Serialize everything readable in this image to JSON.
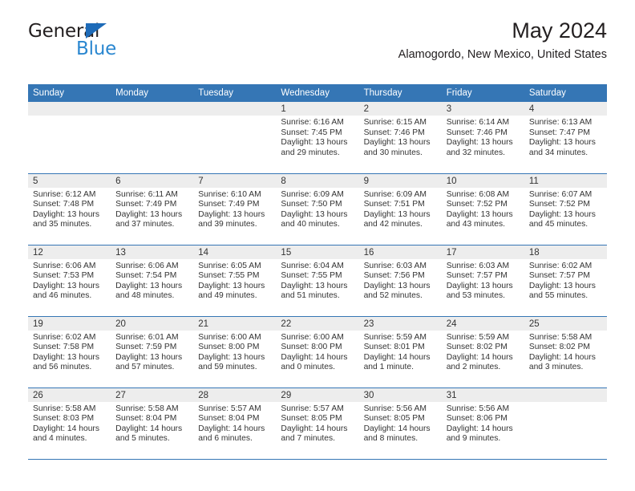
{
  "brand": {
    "name_top": "General",
    "name_bottom": "Blue",
    "triangle_color": "#1e6bb8",
    "blue_color": "#2a87d0",
    "dark_color": "#231f20"
  },
  "header": {
    "title": "May 2024",
    "subtitle": "Alamogordo, New Mexico, United States"
  },
  "theme": {
    "header_blue": "#3576b5",
    "daynum_band": "#ededed",
    "text": "#333333"
  },
  "weekdays": [
    "Sunday",
    "Monday",
    "Tuesday",
    "Wednesday",
    "Thursday",
    "Friday",
    "Saturday"
  ],
  "weeks": [
    [
      {
        "day": "",
        "empty": true
      },
      {
        "day": "",
        "empty": true
      },
      {
        "day": "",
        "empty": true
      },
      {
        "day": "1",
        "sunrise": "Sunrise: 6:16 AM",
        "sunset": "Sunset: 7:45 PM",
        "daylight": "Daylight: 13 hours and 29 minutes."
      },
      {
        "day": "2",
        "sunrise": "Sunrise: 6:15 AM",
        "sunset": "Sunset: 7:46 PM",
        "daylight": "Daylight: 13 hours and 30 minutes."
      },
      {
        "day": "3",
        "sunrise": "Sunrise: 6:14 AM",
        "sunset": "Sunset: 7:46 PM",
        "daylight": "Daylight: 13 hours and 32 minutes."
      },
      {
        "day": "4",
        "sunrise": "Sunrise: 6:13 AM",
        "sunset": "Sunset: 7:47 PM",
        "daylight": "Daylight: 13 hours and 34 minutes."
      }
    ],
    [
      {
        "day": "5",
        "sunrise": "Sunrise: 6:12 AM",
        "sunset": "Sunset: 7:48 PM",
        "daylight": "Daylight: 13 hours and 35 minutes."
      },
      {
        "day": "6",
        "sunrise": "Sunrise: 6:11 AM",
        "sunset": "Sunset: 7:49 PM",
        "daylight": "Daylight: 13 hours and 37 minutes."
      },
      {
        "day": "7",
        "sunrise": "Sunrise: 6:10 AM",
        "sunset": "Sunset: 7:49 PM",
        "daylight": "Daylight: 13 hours and 39 minutes."
      },
      {
        "day": "8",
        "sunrise": "Sunrise: 6:09 AM",
        "sunset": "Sunset: 7:50 PM",
        "daylight": "Daylight: 13 hours and 40 minutes."
      },
      {
        "day": "9",
        "sunrise": "Sunrise: 6:09 AM",
        "sunset": "Sunset: 7:51 PM",
        "daylight": "Daylight: 13 hours and 42 minutes."
      },
      {
        "day": "10",
        "sunrise": "Sunrise: 6:08 AM",
        "sunset": "Sunset: 7:52 PM",
        "daylight": "Daylight: 13 hours and 43 minutes."
      },
      {
        "day": "11",
        "sunrise": "Sunrise: 6:07 AM",
        "sunset": "Sunset: 7:52 PM",
        "daylight": "Daylight: 13 hours and 45 minutes."
      }
    ],
    [
      {
        "day": "12",
        "sunrise": "Sunrise: 6:06 AM",
        "sunset": "Sunset: 7:53 PM",
        "daylight": "Daylight: 13 hours and 46 minutes."
      },
      {
        "day": "13",
        "sunrise": "Sunrise: 6:06 AM",
        "sunset": "Sunset: 7:54 PM",
        "daylight": "Daylight: 13 hours and 48 minutes."
      },
      {
        "day": "14",
        "sunrise": "Sunrise: 6:05 AM",
        "sunset": "Sunset: 7:55 PM",
        "daylight": "Daylight: 13 hours and 49 minutes."
      },
      {
        "day": "15",
        "sunrise": "Sunrise: 6:04 AM",
        "sunset": "Sunset: 7:55 PM",
        "daylight": "Daylight: 13 hours and 51 minutes."
      },
      {
        "day": "16",
        "sunrise": "Sunrise: 6:03 AM",
        "sunset": "Sunset: 7:56 PM",
        "daylight": "Daylight: 13 hours and 52 minutes."
      },
      {
        "day": "17",
        "sunrise": "Sunrise: 6:03 AM",
        "sunset": "Sunset: 7:57 PM",
        "daylight": "Daylight: 13 hours and 53 minutes."
      },
      {
        "day": "18",
        "sunrise": "Sunrise: 6:02 AM",
        "sunset": "Sunset: 7:57 PM",
        "daylight": "Daylight: 13 hours and 55 minutes."
      }
    ],
    [
      {
        "day": "19",
        "sunrise": "Sunrise: 6:02 AM",
        "sunset": "Sunset: 7:58 PM",
        "daylight": "Daylight: 13 hours and 56 minutes."
      },
      {
        "day": "20",
        "sunrise": "Sunrise: 6:01 AM",
        "sunset": "Sunset: 7:59 PM",
        "daylight": "Daylight: 13 hours and 57 minutes."
      },
      {
        "day": "21",
        "sunrise": "Sunrise: 6:00 AM",
        "sunset": "Sunset: 8:00 PM",
        "daylight": "Daylight: 13 hours and 59 minutes."
      },
      {
        "day": "22",
        "sunrise": "Sunrise: 6:00 AM",
        "sunset": "Sunset: 8:00 PM",
        "daylight": "Daylight: 14 hours and 0 minutes."
      },
      {
        "day": "23",
        "sunrise": "Sunrise: 5:59 AM",
        "sunset": "Sunset: 8:01 PM",
        "daylight": "Daylight: 14 hours and 1 minute."
      },
      {
        "day": "24",
        "sunrise": "Sunrise: 5:59 AM",
        "sunset": "Sunset: 8:02 PM",
        "daylight": "Daylight: 14 hours and 2 minutes."
      },
      {
        "day": "25",
        "sunrise": "Sunrise: 5:58 AM",
        "sunset": "Sunset: 8:02 PM",
        "daylight": "Daylight: 14 hours and 3 minutes."
      }
    ],
    [
      {
        "day": "26",
        "sunrise": "Sunrise: 5:58 AM",
        "sunset": "Sunset: 8:03 PM",
        "daylight": "Daylight: 14 hours and 4 minutes."
      },
      {
        "day": "27",
        "sunrise": "Sunrise: 5:58 AM",
        "sunset": "Sunset: 8:04 PM",
        "daylight": "Daylight: 14 hours and 5 minutes."
      },
      {
        "day": "28",
        "sunrise": "Sunrise: 5:57 AM",
        "sunset": "Sunset: 8:04 PM",
        "daylight": "Daylight: 14 hours and 6 minutes."
      },
      {
        "day": "29",
        "sunrise": "Sunrise: 5:57 AM",
        "sunset": "Sunset: 8:05 PM",
        "daylight": "Daylight: 14 hours and 7 minutes."
      },
      {
        "day": "30",
        "sunrise": "Sunrise: 5:56 AM",
        "sunset": "Sunset: 8:05 PM",
        "daylight": "Daylight: 14 hours and 8 minutes."
      },
      {
        "day": "31",
        "sunrise": "Sunrise: 5:56 AM",
        "sunset": "Sunset: 8:06 PM",
        "daylight": "Daylight: 14 hours and 9 minutes."
      },
      {
        "day": "",
        "empty": true
      }
    ]
  ]
}
